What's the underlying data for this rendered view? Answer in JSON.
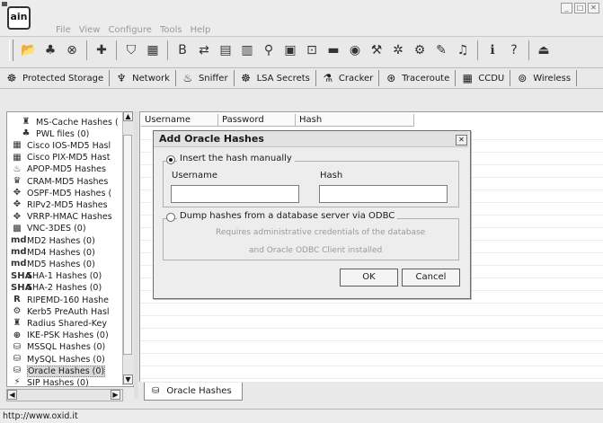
{
  "app": {
    "logo_text": "ain"
  },
  "menu": [
    "File",
    "View",
    "Configure",
    "Tools",
    "Help"
  ],
  "window_buttons": [
    "_",
    "□",
    "✕"
  ],
  "toolbar_icons": [
    {
      "name": "open-icon",
      "glyph": "📂"
    },
    {
      "name": "cookie-icon",
      "glyph": "♣"
    },
    {
      "name": "network-icon",
      "glyph": "⊗"
    },
    {
      "name": "add-icon",
      "glyph": "✚"
    },
    {
      "name": "shield-icon",
      "glyph": "⛉"
    },
    {
      "name": "grid-icon",
      "glyph": "▦"
    },
    {
      "name": "base64-icon",
      "glyph": "B"
    },
    {
      "name": "route-icon",
      "glyph": "⇄"
    },
    {
      "name": "hash-table-icon",
      "glyph": "▤"
    },
    {
      "name": "hash-table2-icon",
      "glyph": "▥"
    },
    {
      "name": "antenna-icon",
      "glyph": "⚲"
    },
    {
      "name": "pc-icon",
      "glyph": "▣"
    },
    {
      "name": "password-box-icon",
      "glyph": "⊡"
    },
    {
      "name": "hdd-icon",
      "glyph": "▬"
    },
    {
      "name": "disk-icon",
      "glyph": "◉"
    },
    {
      "name": "tools-icon",
      "glyph": "⚒"
    },
    {
      "name": "wrench-icon",
      "glyph": "✲"
    },
    {
      "name": "gear-icon",
      "glyph": "⚙"
    },
    {
      "name": "edit-icon",
      "glyph": "✎"
    },
    {
      "name": "sound-icon",
      "glyph": "♫"
    },
    {
      "name": "info-icon",
      "glyph": "ℹ"
    },
    {
      "name": "help-icon",
      "glyph": "?"
    },
    {
      "name": "exit-icon",
      "glyph": "⏏"
    }
  ],
  "tabs": [
    {
      "label": "Protected Storage",
      "icon": "☸"
    },
    {
      "label": "Network",
      "icon": "♆"
    },
    {
      "label": "Sniffer",
      "icon": "♨"
    },
    {
      "label": "LSA Secrets",
      "icon": "☸"
    },
    {
      "label": "Cracker",
      "icon": "⚗"
    },
    {
      "label": "Traceroute",
      "icon": "⊛"
    },
    {
      "label": "CCDU",
      "icon": "▦"
    },
    {
      "label": "Wireless",
      "icon": "⊚"
    }
  ],
  "tree": [
    {
      "label": "MS-Cache Hashes (",
      "icon": "♜"
    },
    {
      "label": "PWL files (0)",
      "icon": "♣"
    },
    {
      "label": "Cisco IOS-MD5 Hasl",
      "icon": "▦"
    },
    {
      "label": "Cisco PIX-MD5 Hast",
      "icon": "▦"
    },
    {
      "label": "APOP-MD5 Hashes",
      "icon": "♨"
    },
    {
      "label": "CRAM-MD5 Hashes",
      "icon": "♛"
    },
    {
      "label": "OSPF-MD5 Hashes (",
      "icon": "✥"
    },
    {
      "label": "RIPv2-MD5 Hashes",
      "icon": "✥"
    },
    {
      "label": "VRRP-HMAC Hashes",
      "icon": "✥"
    },
    {
      "label": "VNC-3DES (0)",
      "icon": "▩"
    },
    {
      "label": "MD2 Hashes (0)",
      "icon": "md"
    },
    {
      "label": "MD4 Hashes (0)",
      "icon": "md"
    },
    {
      "label": "MD5 Hashes (0)",
      "icon": "md"
    },
    {
      "label": "SHA-1 Hashes (0)",
      "icon": "SHA"
    },
    {
      "label": "SHA-2 Hashes (0)",
      "icon": "SHA"
    },
    {
      "label": "RIPEMD-160 Hashe",
      "icon": "R"
    },
    {
      "label": "Kerb5 PreAuth Hasl",
      "icon": "⚙"
    },
    {
      "label": "Radius Shared-Key",
      "icon": "♜"
    },
    {
      "label": "IKE-PSK Hashes (0)",
      "icon": "⊕"
    },
    {
      "label": "MSSQL Hashes (0)",
      "icon": "⛁"
    },
    {
      "label": "MySQL Hashes (0)",
      "icon": "⛁"
    },
    {
      "label": "Oracle Hashes (0)",
      "icon": "⛁"
    },
    {
      "label": "SIP Hashes (0)",
      "icon": "⚡"
    }
  ],
  "grid": {
    "columns": [
      "Username",
      "Password",
      "Hash"
    ]
  },
  "bottom_tab": {
    "label": "Oracle Hashes",
    "icon": "⛁"
  },
  "status": {
    "text": "http://www.oxid.it"
  },
  "dialog": {
    "title": "Add Oracle Hashes",
    "close_glyph": "✕",
    "manual_option": "Insert the hash manually",
    "username_label": "Username",
    "hash_label": "Hash",
    "username_value": "",
    "hash_value": "",
    "odbc_option": "Dump hashes from a database server via ODBC",
    "odbc_note1": "Requires administrative credentials of the database",
    "odbc_note2": "and Oracle ODBC Client installed",
    "ok_label": "OK",
    "cancel_label": "Cancel",
    "manual_selected": true
  }
}
